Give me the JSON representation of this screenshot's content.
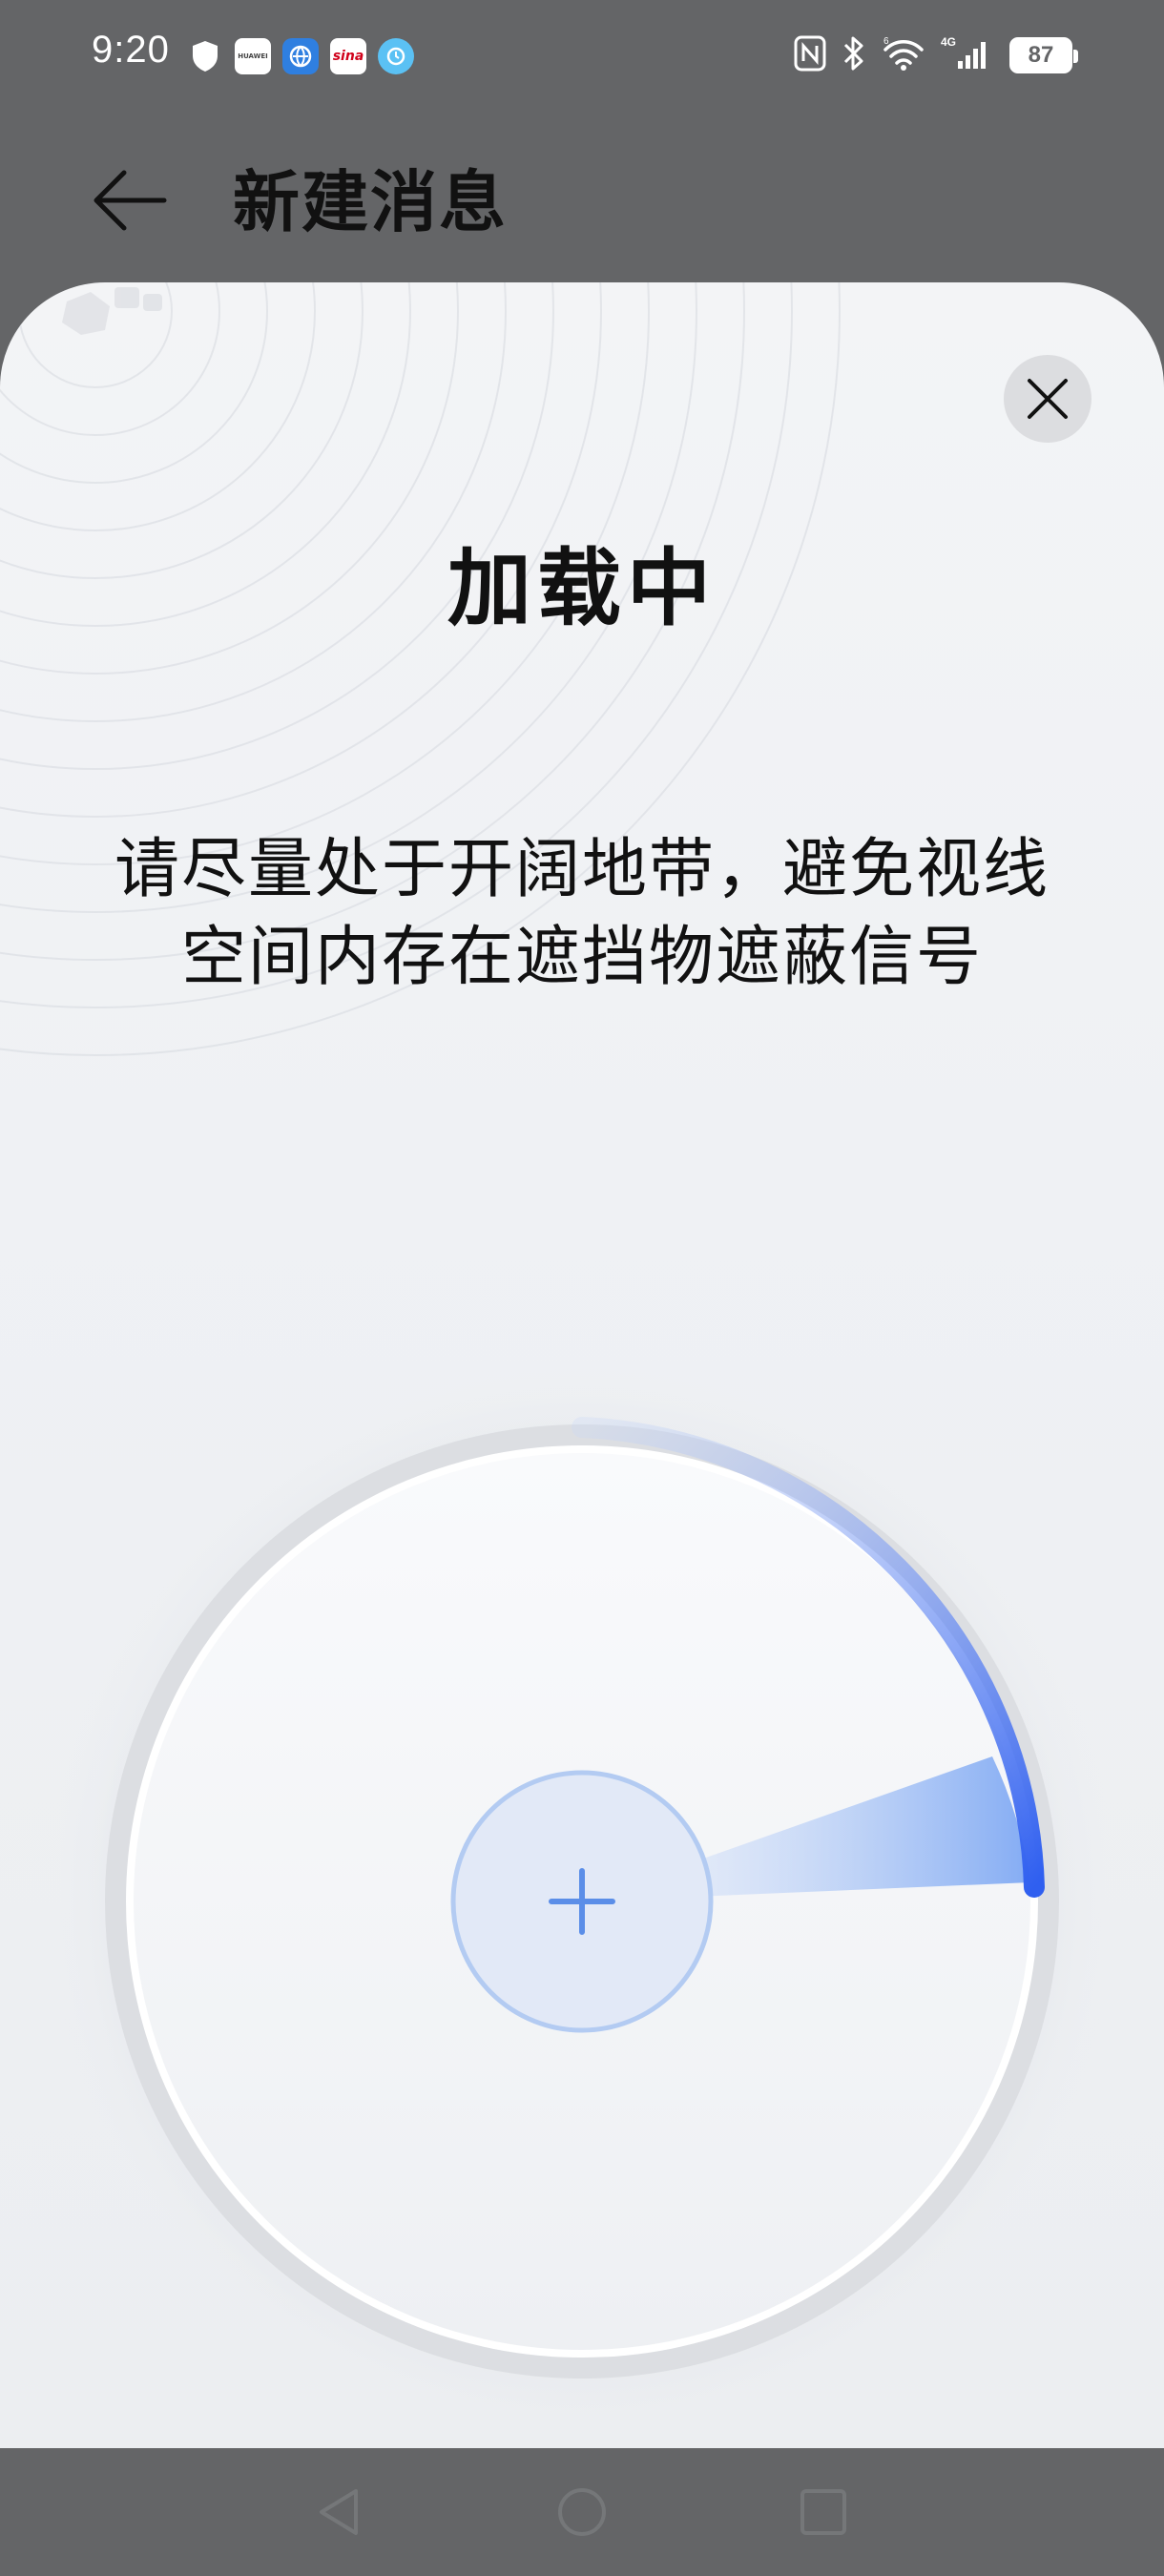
{
  "status_bar": {
    "time": "9:20",
    "battery": "87",
    "notification_icons": [
      "shield-icon",
      "huawei-icon",
      "browser-icon",
      "sina-icon",
      "clock-icon"
    ],
    "system_icons": [
      "nfc-icon",
      "bluetooth-icon",
      "wifi-icon",
      "cellular-4g-icon",
      "battery-icon"
    ],
    "huawei_label": "HUAWEI",
    "sina_label": "sina"
  },
  "app_bar": {
    "title": "新建消息",
    "back_icon": "arrow-left-icon"
  },
  "sheet": {
    "title": "加载中",
    "hint": "请尽量处于开阔地带，避免视线空间内存在遮挡物遮蔽信号",
    "close_icon": "close-icon",
    "center_icon": "plus-icon",
    "scan_progress": 0.16,
    "colors": {
      "accent": "#2f5ff0",
      "accent_light": "#a9c6f7",
      "center_fill": "#e2e9f7",
      "center_border": "#b3cbf2"
    }
  },
  "nav_bar": {
    "items": [
      "back-triangle-icon",
      "home-circle-icon",
      "recents-square-icon"
    ]
  }
}
